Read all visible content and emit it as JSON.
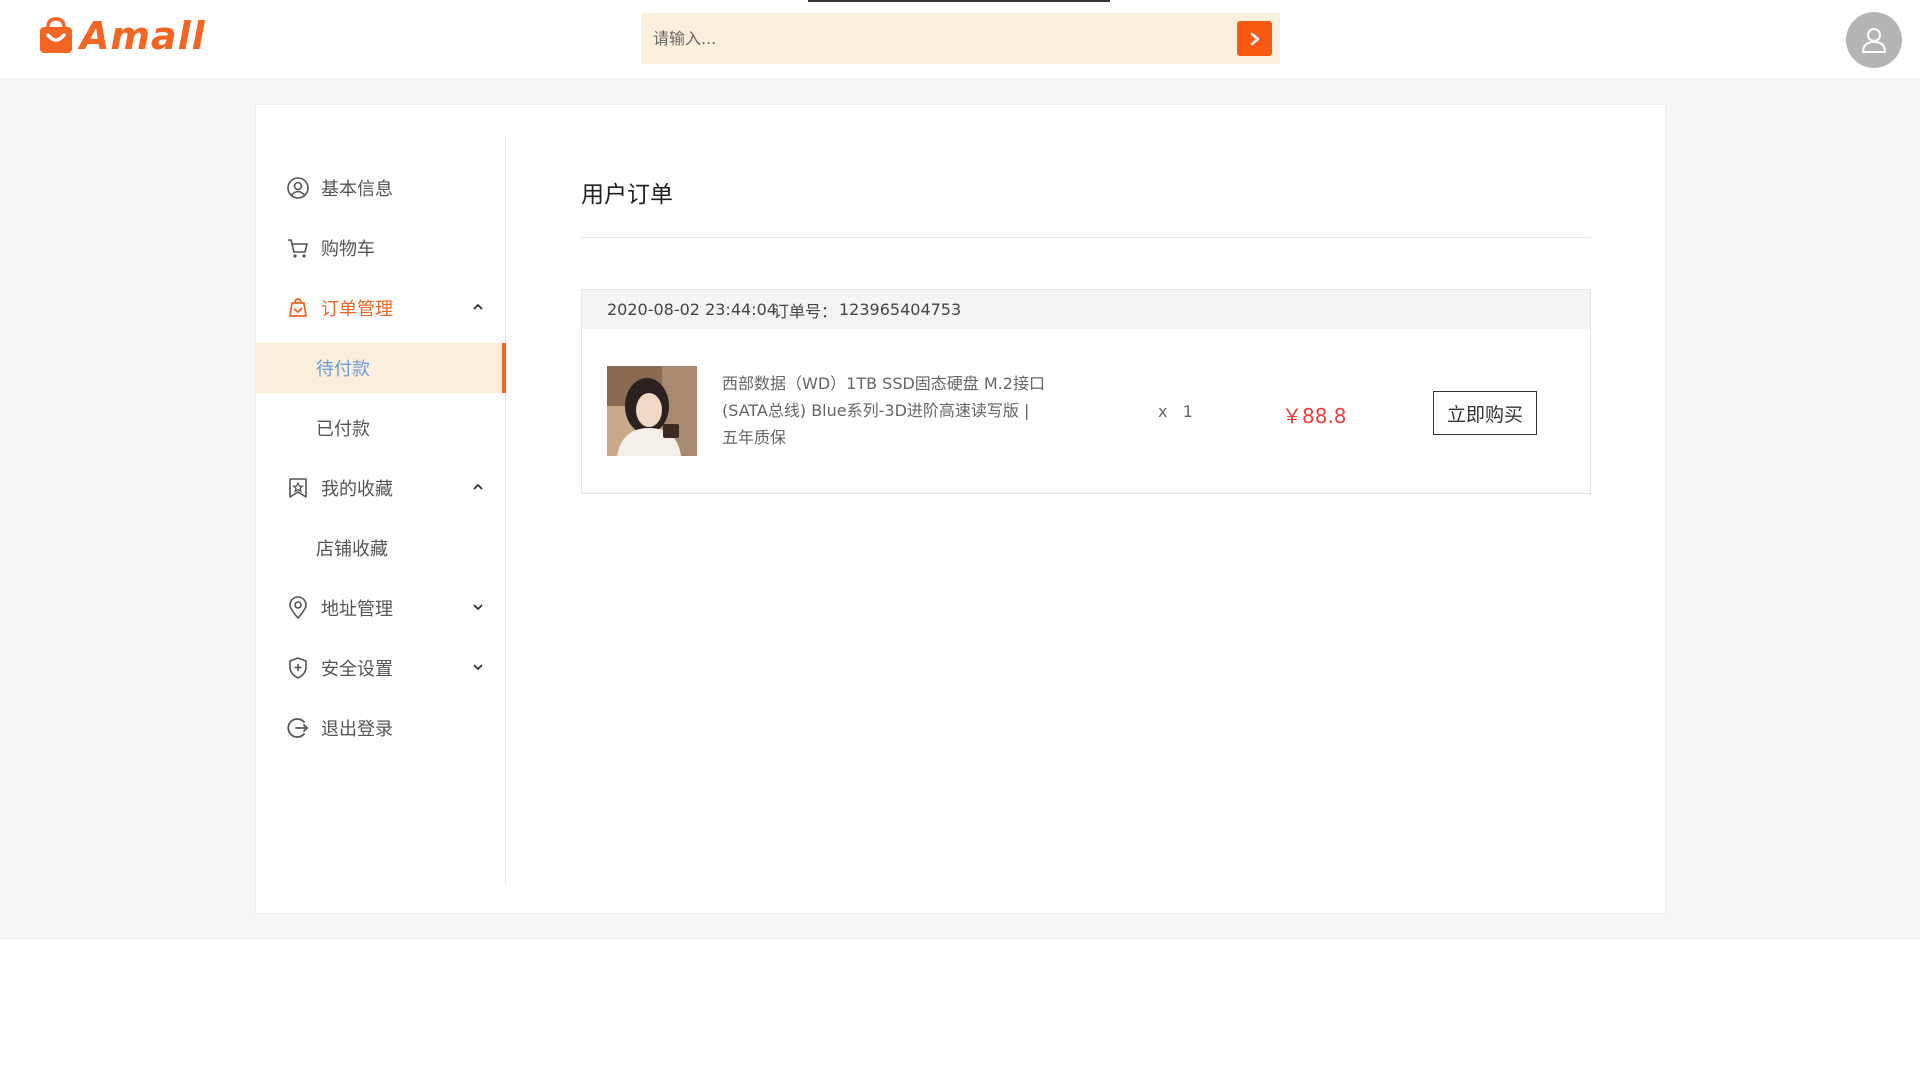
{
  "header": {
    "logo_text": "Amall",
    "search": {
      "placeholder": "请输入...",
      "value": ""
    },
    "colors": {
      "brand": "#f26522",
      "search_bg": "#f9efdc",
      "search_btn": "#f85a14"
    }
  },
  "sidebar": {
    "items": [
      {
        "label": "基本信息",
        "icon": "user-circle-icon"
      },
      {
        "label": "购物车",
        "icon": "cart-icon"
      },
      {
        "label": "订单管理",
        "icon": "order-icon",
        "expanded": true,
        "children": [
          {
            "label": "待付款",
            "selected": true
          },
          {
            "label": "已付款"
          }
        ]
      },
      {
        "label": "我的收藏",
        "icon": "favorite-icon",
        "expanded": true,
        "children": [
          {
            "label": "店铺收藏"
          }
        ]
      },
      {
        "label": "地址管理",
        "icon": "location-icon",
        "expanded": false
      },
      {
        "label": "安全设置",
        "icon": "shield-icon",
        "expanded": false
      },
      {
        "label": "退出登录",
        "icon": "logout-icon"
      }
    ]
  },
  "main": {
    "title": "用户订单",
    "orders": [
      {
        "date": "2020-08-02 23:44:04",
        "order_no_label": "订单号：",
        "order_no": "123965404753",
        "product_name_lines": [
          "西部数据（WD）1TB SSD固态硬盘 M.2接口",
          "(SATA总线) Blue系列-3D进阶高速读写版 |",
          "五年质保"
        ],
        "quantity": "x   1",
        "price": "￥88.8",
        "buy_label": "立即购买"
      }
    ]
  }
}
